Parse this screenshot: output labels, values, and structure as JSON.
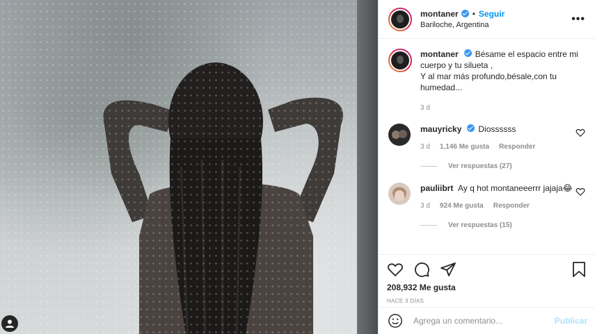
{
  "post": {
    "author": "montaner",
    "location": "Bariloche, Argentina",
    "follow_label": "Seguir",
    "dot": "•",
    "more_label": "•••",
    "caption": "Bésame el espacio entre mi cuerpo y tu silueta ,\nY al mar más profundo,bésale,con tu humedad...",
    "caption_time": "3 d"
  },
  "comments": [
    {
      "user": "mauyricky",
      "verified": true,
      "text": "Diossssss",
      "time": "3 d",
      "likes": "1,146 Me gusta",
      "reply_label": "Responder",
      "view_replies": "Ver respuestas (27)"
    },
    {
      "user": "pauliibrt",
      "verified": false,
      "text": "Ay q hot montaneeerrr jajaja😂",
      "time": "3 d",
      "likes": "924 Me gusta",
      "reply_label": "Responder",
      "view_replies": "Ver respuestas (15)"
    }
  ],
  "actions": {
    "likes": "208,932 Me gusta",
    "posted_ago": "HACE 3 DÍAS",
    "icons": [
      "heart-icon",
      "comment-icon",
      "share-icon",
      "bookmark-icon"
    ]
  },
  "add_comment": {
    "placeholder": "Agrega un comentario...",
    "post_label": "Publicar"
  },
  "colors": {
    "accent": "#0095f6",
    "verified": "#3897f0",
    "muted": "#8e8e8e",
    "post_disabled": "#b2dffc"
  }
}
